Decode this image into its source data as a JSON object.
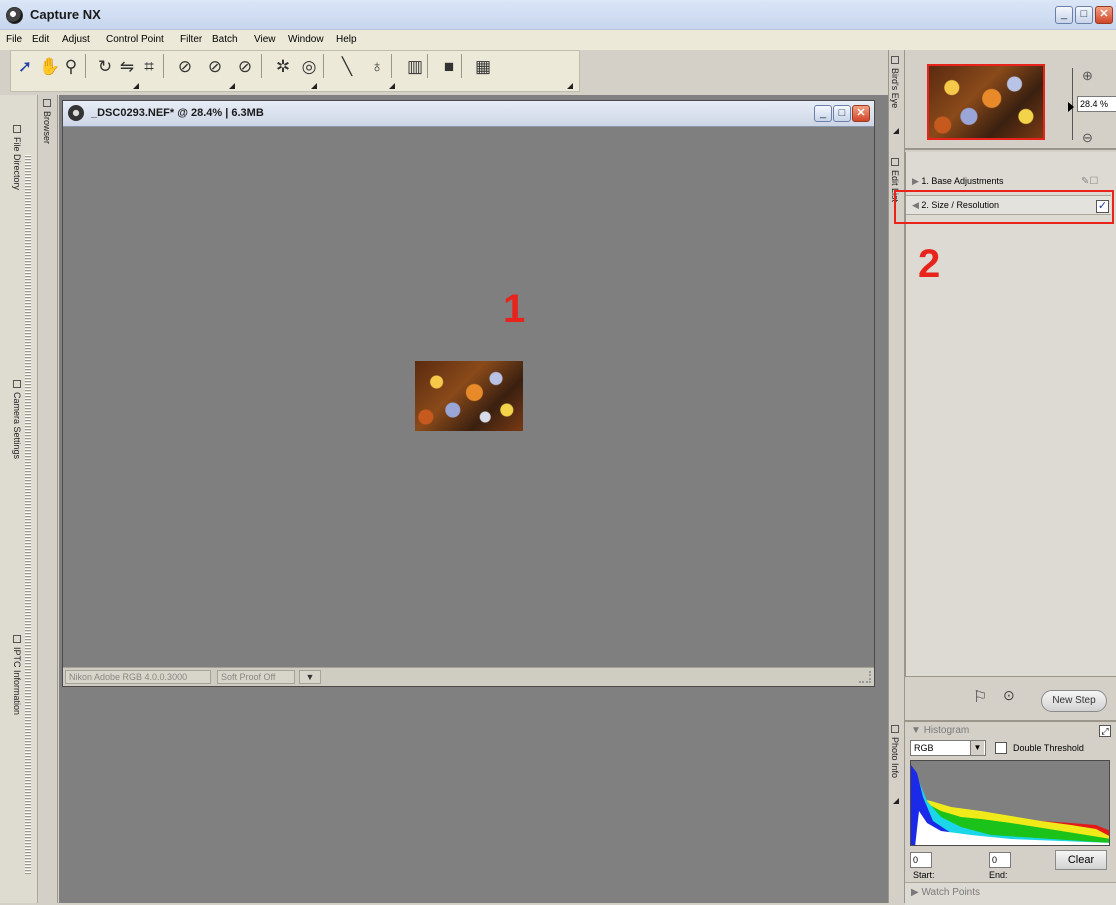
{
  "app": {
    "title": "Capture NX"
  },
  "menu": [
    "File",
    "Edit",
    "Adjust",
    "Control Point",
    "Filter",
    "Batch",
    "View",
    "Window",
    "Help"
  ],
  "toolbar": {
    "icons": [
      "arrow-select-icon",
      "hand-icon",
      "zoom-icon",
      "rotate-icon",
      "straighten-icon",
      "crop-icon",
      "black-point-icon",
      "neutral-point-icon",
      "white-point-icon",
      "red-eye-icon",
      "lasso-icon",
      "line-icon",
      "brush-icon",
      "gradient-icon",
      "fill-icon",
      "fill-remove-icon"
    ]
  },
  "left_panel": {
    "tabs": [
      "File Directory",
      "Camera Settings",
      "IPTC Information"
    ],
    "browser_tab": "Browser"
  },
  "document": {
    "title": "_DSC0293.NEF* @ 28.4% | 6.3MB",
    "status_profile": "Nikon Adobe RGB 4.0.0.3000",
    "status_proof": "Soft Proof Off"
  },
  "annotations": {
    "marker1": "1",
    "marker2": "2",
    "highlight_color": "#e8231c"
  },
  "birdseye": {
    "tab": "Bird's Eye",
    "zoom_value": "28.4 %"
  },
  "edit_list": {
    "tab": "Edit List",
    "steps": [
      {
        "label": "1. Base Adjustments",
        "enabled": true
      },
      {
        "label": "2. Size / Resolution",
        "enabled": true
      }
    ],
    "new_step_label": "New Step"
  },
  "photo_info": {
    "tab": "Photo Info",
    "histogram_title": "Histogram",
    "channel": "RGB",
    "double_threshold_label": "Double Threshold",
    "start_value": "0",
    "end_value": "0",
    "start_label": "Start:",
    "end_label": "End:",
    "clear_label": "Clear",
    "watch_points_label": "Watch Points"
  }
}
